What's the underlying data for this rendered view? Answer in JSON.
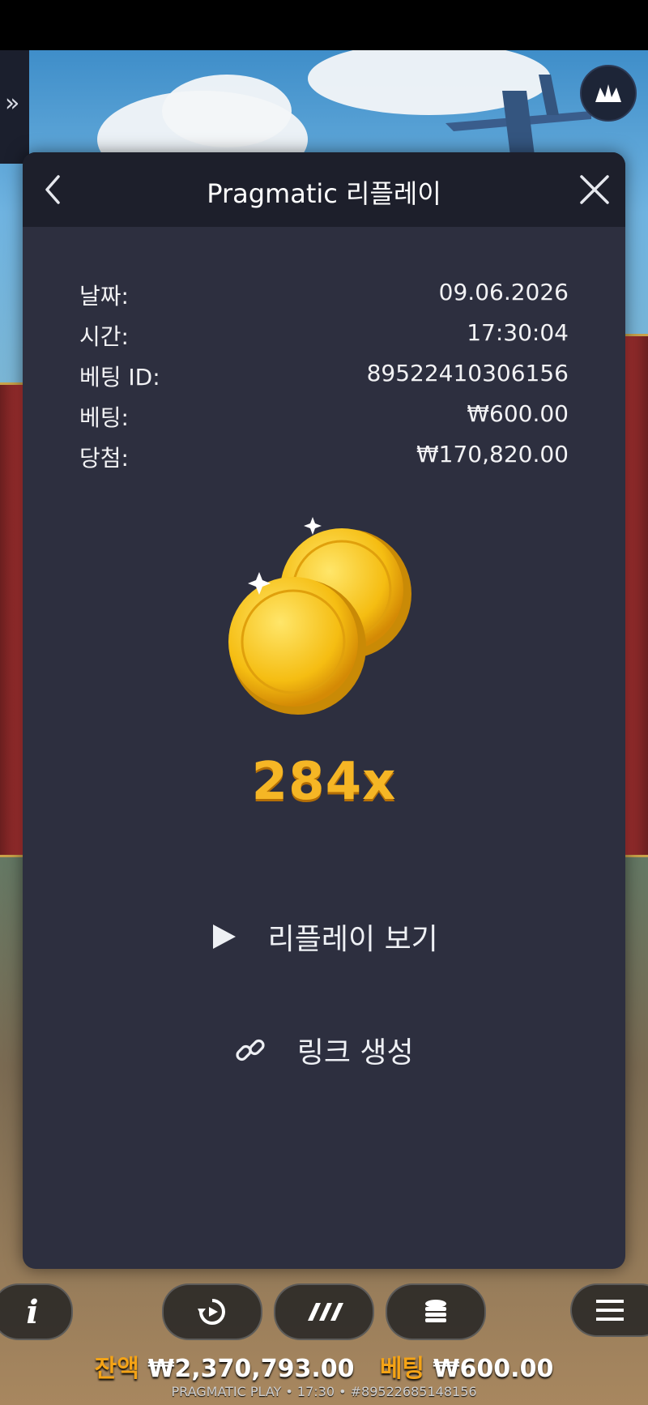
{
  "modal": {
    "title": "Pragmatic 리플레이",
    "rows": [
      {
        "label": "날짜:",
        "value": "09.06.2026"
      },
      {
        "label": "시간:",
        "value": "17:30:04"
      },
      {
        "label": "베팅 ID:",
        "value": "89522410306156"
      },
      {
        "label": "베팅:",
        "value": "₩600.00"
      },
      {
        "label": "당첨:",
        "value": "₩170,820.00"
      }
    ],
    "multiplier": "284x",
    "watch_replay_label": "리플레이 보기",
    "create_link_label": "링크 생성"
  },
  "game_bar": {
    "balance_label": "잔액",
    "balance_value": "₩2,370,793.00",
    "bet_label": "베팅",
    "bet_value": "₩600.00",
    "footer": "PRAGMATIC PLAY • 17:30 • #89522685148156"
  },
  "icons": {
    "back": "chevron-left-icon",
    "close": "close-icon",
    "play": "play-icon",
    "link": "link-icon",
    "info": "info-icon",
    "autoplay": "autoplay-icon",
    "turbo": "turbo-icon",
    "bet": "coin-stack-icon",
    "menu": "menu-icon"
  },
  "colors": {
    "modal_bg": "#2d2f3f",
    "header_bg": "#1d1f2b",
    "multiplier": "#f5b625",
    "balance_label": "#f4a316"
  }
}
